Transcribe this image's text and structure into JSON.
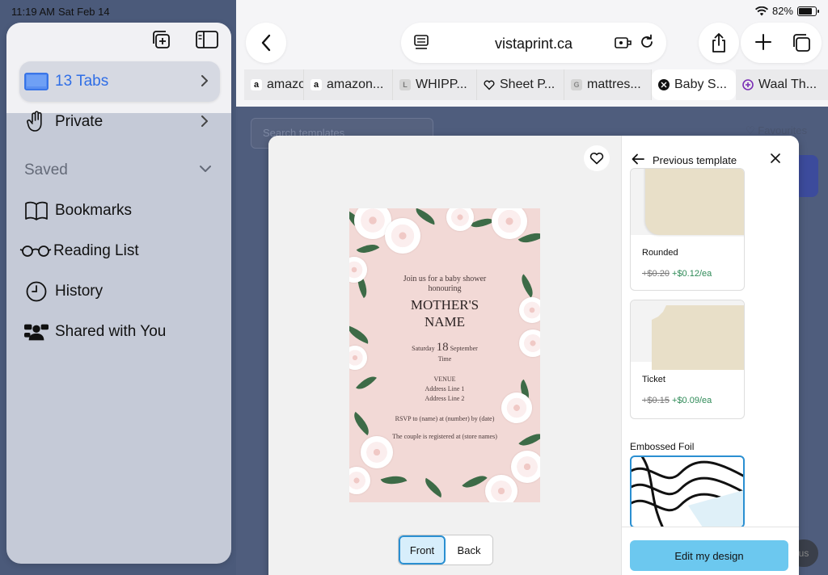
{
  "status": {
    "time": "11:19 AM",
    "date": "Sat Feb 14",
    "battery": "82%",
    "battery_level": 0.82
  },
  "browser": {
    "url": "vistaprint.ca",
    "tabs": [
      {
        "label": "amazon",
        "icon": "amazon-icon",
        "active": false
      },
      {
        "label": "amazon...",
        "icon": "amazon-icon",
        "active": false
      },
      {
        "label": "WHIPP...",
        "icon": "page-icon",
        "active": false
      },
      {
        "label": "Sheet P...",
        "icon": "heart-favicon",
        "active": false
      },
      {
        "label": "mattres...",
        "icon": "generic-icon",
        "active": false
      },
      {
        "label": "Baby S...",
        "icon": "close-icon",
        "active": true
      },
      {
        "label": "Waal Th...",
        "icon": "plus-circle-icon",
        "active": false
      }
    ]
  },
  "sidebar": {
    "tabs_label": "13 Tabs",
    "private_label": "Private",
    "saved_label": "Saved",
    "items": [
      {
        "label": "Bookmarks",
        "icon": "book-icon"
      },
      {
        "label": "Reading List",
        "icon": "glasses-icon"
      },
      {
        "label": "History",
        "icon": "clock-icon"
      },
      {
        "label": "Shared with You",
        "icon": "people-icon"
      }
    ]
  },
  "page_bg": {
    "search_placeholder": "Search templates",
    "favourites": "Favourites",
    "pill": "us"
  },
  "card": {
    "line1": "Join us for a baby shower",
    "line2": "honouring",
    "name_line1": "MOTHER'S",
    "name_line2": "NAME",
    "date_day": "Saturday",
    "date_num": "18",
    "date_month": "September",
    "time": "Time",
    "venue": "VENUE",
    "address1": "Address Line 1",
    "address2": "Address Line 2",
    "rsvp": "RSVP to (name) at (number) by (date)",
    "registry": "The couple is registered at (store names)"
  },
  "modal": {
    "front": "Front",
    "back": "Back",
    "previous": "Previous template",
    "options": [
      {
        "name": "Rounded",
        "old_price": "+$0.20",
        "new_price": "+$0.12/ea"
      },
      {
        "name": "Ticket",
        "old_price": "+$0.15",
        "new_price": "+$0.09/ea"
      }
    ],
    "section": "Embossed Foil",
    "edit": "Edit my design"
  }
}
